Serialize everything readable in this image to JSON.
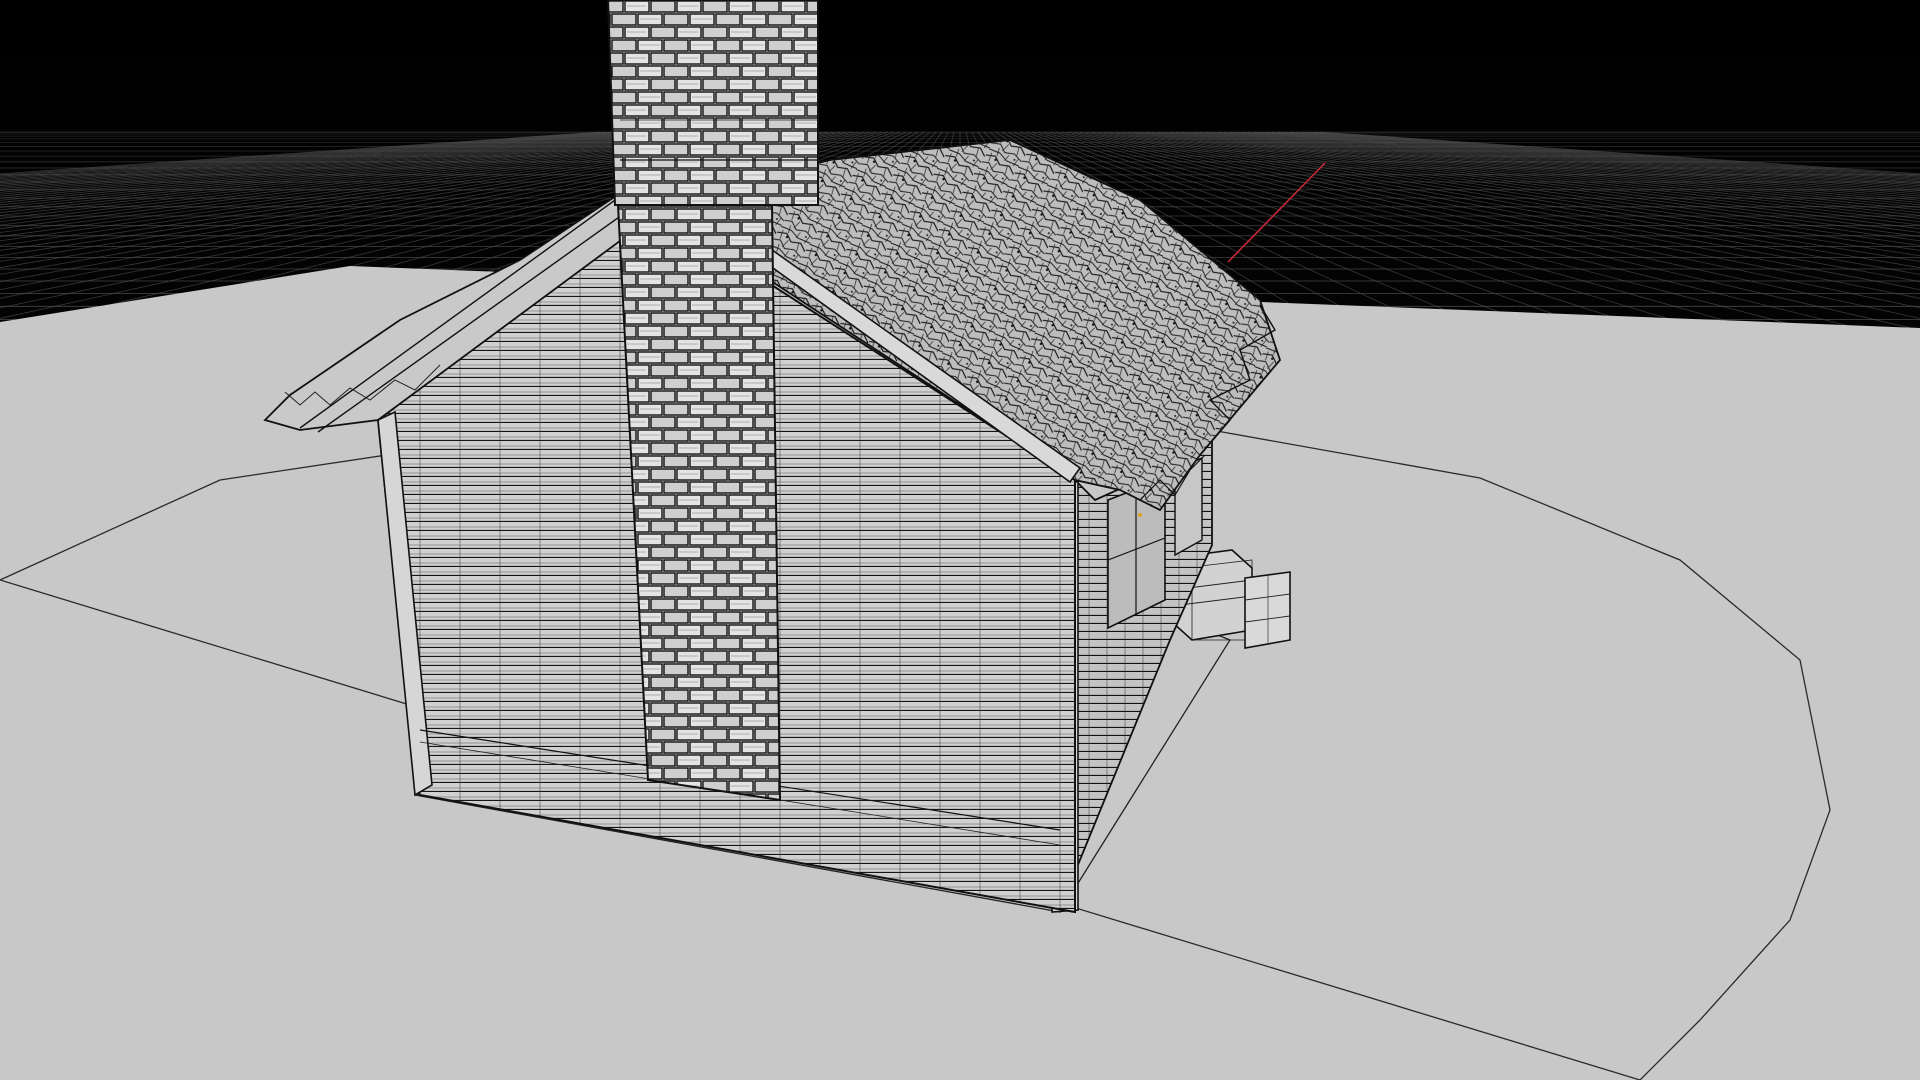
{
  "viewport": {
    "mode": "wireframe-on-shaded",
    "background_color": "#050505",
    "grid_color": "#5a5a5a",
    "axis_color": "#c8283a",
    "ground_color": "#c8c8c8",
    "mesh_fill_color": "#d4d4d4",
    "edge_color": "#111111",
    "highlight_color": "#e0a020"
  },
  "scene": {
    "objects": [
      "ground-grid",
      "ground-disc",
      "cabin",
      "chimney",
      "roof",
      "porch-steps"
    ]
  }
}
